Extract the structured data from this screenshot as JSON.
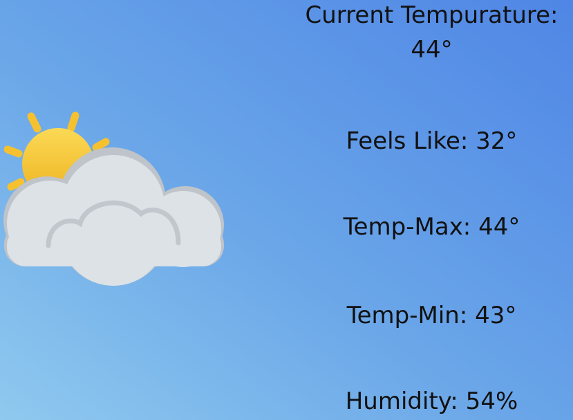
{
  "weather": {
    "icon": "partly-cloudy-icon",
    "current_label": "Current Tempurature:",
    "current_value": "44°",
    "feels_like": "Feels Like: 32°",
    "temp_max": "Temp-Max: 44°",
    "temp_min": "Temp-Min: 43°",
    "humidity": "Humidity: 54%"
  },
  "colors": {
    "background_top": "#4f86e6",
    "background_bottom": "#8fc9ef",
    "sun": "#f6c12f",
    "cloud": "#dde2e7",
    "cloud_outline": "#b7bcc3"
  }
}
